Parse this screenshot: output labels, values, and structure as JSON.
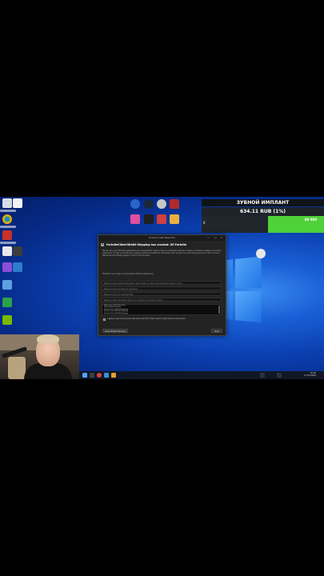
{
  "stream_overlay": {
    "title": "ЗУБНОЙ ИМПЛАНТ",
    "amount": "634.11 RUB (1%)",
    "progress_start": "0",
    "progress_goal": "60 000",
    "progress_percent": 1,
    "colors": {
      "fill": "#4fd13a",
      "track": "#20262b"
    }
  },
  "crash_dialog": {
    "window_title": "Unreal Crash Reporter",
    "window_controls": "— ▢ ✕",
    "heading": "FortniteClient-Win64-Shipping has crashed: UE-Fortnite",
    "body_text": "We are very sorry that this application has unexpectedly crashed. We are constantly working on fixing all crashes to deliver a smoother experience. To help us fix the issue, please include any additional information such as what you were doing when the crash occurred. Please see the following steps on how to fix this issue...",
    "body_text_2": "Thanks for your help in improving the Fortnite experience.",
    "fields": [
      "Please provide detailed information about what you were doing when the crash occurred",
      "Please provide any steps to reproduce",
      "Please provide any attached files",
      "Please provide information about your system and graphics device"
    ],
    "log_lines": [
      "Fatal error: [File:Unknown]",
      "Unhandled Exception",
      "FortniteClient-Win64-Shipping",
      "FortniteClient-Win64-Shipping",
      "FortniteClient-Win64-Shipping"
    ],
    "checkbox_label": "I agree to send anonymous data along with this crash report to help improve the product",
    "button_left": "Close Without Sending",
    "button_right": "Send"
  },
  "taskbar": {
    "time": "15:40",
    "date": "17.03.2024"
  },
  "desktop_icons": [
    "app-icon",
    "app-icon",
    "app-icon",
    "app-icon",
    "app-icon",
    "app-icon",
    "app-icon",
    "app-icon",
    "app-icon",
    "app-icon",
    "app-icon",
    "app-icon",
    "app-icon",
    "app-icon",
    "app-icon"
  ]
}
